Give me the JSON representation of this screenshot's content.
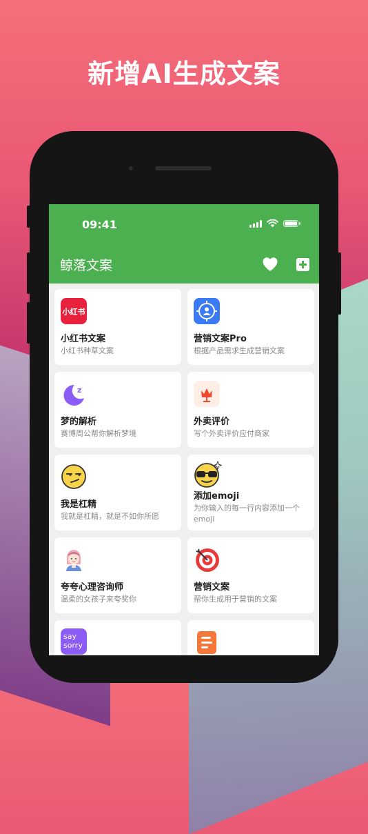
{
  "headline": "新增AI生成文案",
  "status_bar": {
    "time": "09:41"
  },
  "app_bar": {
    "title": "鲸落文案"
  },
  "cards": [
    {
      "title": "小红书文案",
      "desc": "小红书种草文案",
      "icon": "xiaohongshu-logo",
      "icon_text": "小红书",
      "color": "#e8213d"
    },
    {
      "title": "营销文案Pro",
      "desc": "根据产品需求生成营销文案",
      "icon": "target-user-icon",
      "color": "#3a7bf5"
    },
    {
      "title": "梦的解析",
      "desc": "赛博周公帮你解析梦境",
      "icon": "moon-sleep-icon",
      "color": "#8b5cf6"
    },
    {
      "title": "外卖评价",
      "desc": "写个外卖评价应付商家",
      "icon": "flower-icon",
      "color": "#ef4a2f"
    },
    {
      "title": "我是杠精",
      "desc": "我就是杠精，就是不如你所愿",
      "icon": "smirk-emoji-icon",
      "color": "#f7d24b"
    },
    {
      "title": "添加emoji",
      "desc": "为你输入的每一行内容添加一个emoji",
      "icon": "sunglasses-emoji-icon",
      "color": "#f7d24b"
    },
    {
      "title": "夸夸心理咨询师",
      "desc": "温柔的女孩子来夸奖你",
      "icon": "girl-avatar-icon",
      "color": "#f3a6b7"
    },
    {
      "title": "营销文案",
      "desc": "帮你生成用于营销的文案",
      "icon": "dart-target-icon",
      "color": "#e83a3a"
    },
    {
      "title": "",
      "desc": "",
      "icon": "say-sorry-icon",
      "icon_text": "say sorry",
      "color": "#8b5cf6"
    },
    {
      "title": "",
      "desc": "",
      "icon": "document-icon",
      "color": "#f5773a"
    }
  ]
}
